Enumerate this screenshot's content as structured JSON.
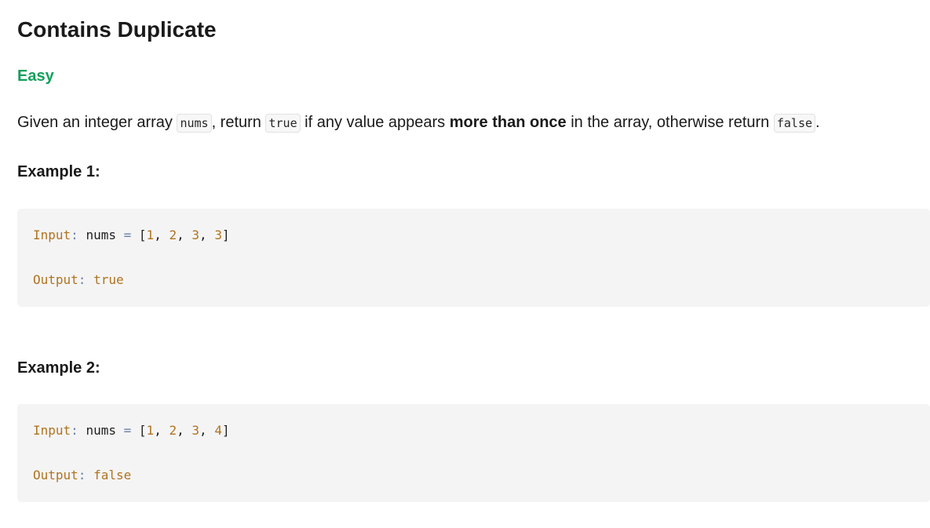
{
  "problem": {
    "title": "Contains Duplicate",
    "difficulty": "Easy",
    "difficulty_color": "#14a05a",
    "description": {
      "p1": "Given an integer array ",
      "code1": "nums",
      "p2": ", return ",
      "code2": "true",
      "p3": " if any value appears ",
      "bold": "more than once",
      "p4": " in the array, otherwise return ",
      "code3": "false",
      "p5": "."
    }
  },
  "examples": [
    {
      "heading": "Example 1:",
      "input_label": "Input",
      "colon": ":",
      "var_name": "nums",
      "equals": "=",
      "open_bracket": "[",
      "values": [
        "1",
        "2",
        "3",
        "3"
      ],
      "comma": ",",
      "close_bracket": "]",
      "output_label": "Output",
      "output_value": "true"
    },
    {
      "heading": "Example 2:",
      "input_label": "Input",
      "colon": ":",
      "var_name": "nums",
      "equals": "=",
      "open_bracket": "[",
      "values": [
        "1",
        "2",
        "3",
        "4"
      ],
      "comma": ",",
      "close_bracket": "]",
      "output_label": "Output",
      "output_value": "false"
    }
  ]
}
